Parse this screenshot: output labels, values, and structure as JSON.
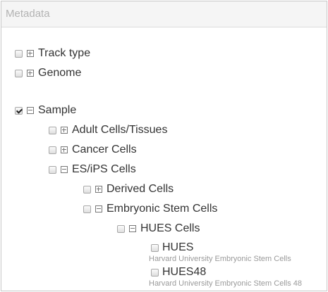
{
  "panel": {
    "title": "Metadata"
  },
  "tree": {
    "track_type": {
      "label": "Track type",
      "checked": false,
      "expanded": false
    },
    "genome": {
      "label": "Genome",
      "checked": false,
      "expanded": false
    },
    "sample": {
      "label": "Sample",
      "checked": true,
      "expanded": true,
      "adult": {
        "label": "Adult Cells/Tissues",
        "checked": false,
        "expanded": false
      },
      "cancer": {
        "label": "Cancer Cells",
        "checked": false,
        "expanded": false
      },
      "es_ips": {
        "label": "ES/iPS Cells",
        "checked": false,
        "expanded": true,
        "derived": {
          "label": "Derived Cells",
          "checked": false,
          "expanded": false
        },
        "embryonic": {
          "label": "Embryonic Stem Cells",
          "checked": false,
          "expanded": true,
          "hues_cells": {
            "label": "HUES Cells",
            "checked": false,
            "expanded": true,
            "hues": {
              "label": "HUES",
              "description": "Harvard University Embryonic Stem Cells",
              "checked": false
            },
            "hues48": {
              "label": "HUES48",
              "description": "Harvard University Embryonic Stem Cells 48",
              "checked": false
            }
          }
        }
      }
    }
  }
}
